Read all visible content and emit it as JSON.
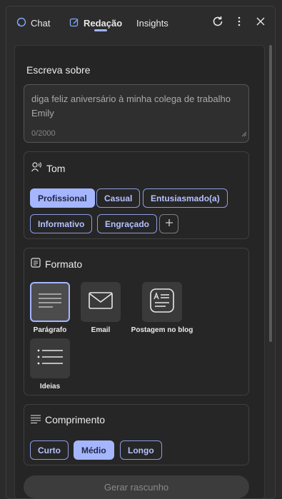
{
  "header": {
    "tabs": [
      {
        "label": "Chat",
        "icon": "chat-bubble-icon"
      },
      {
        "label": "Redação",
        "icon": "compose-icon",
        "active": true
      },
      {
        "label": "Insights"
      }
    ],
    "actions": [
      "refresh-icon",
      "more-vertical-icon",
      "close-icon"
    ]
  },
  "compose": {
    "label": "Escreva sobre",
    "text": "diga feliz aniversário à minha colega de trabalho Emily",
    "counter": "0/2000"
  },
  "tone": {
    "title": "Tom",
    "options": [
      "Profissional",
      "Casual",
      "Entusiasmado(a)",
      "Informativo",
      "Engraçado"
    ],
    "selected": "Profissional"
  },
  "format": {
    "title": "Formato",
    "options": [
      "Parágrafo",
      "Email",
      "Postagem no blog",
      "Ideias"
    ],
    "selected": "Parágrafo"
  },
  "length": {
    "title": "Comprimento",
    "options": [
      "Curto",
      "Médio",
      "Longo"
    ],
    "selected": "Médio"
  },
  "generate_label": "Gerar rascunho",
  "colors": {
    "background": "#2b2b2b",
    "accent": "#a5b6ff",
    "chip_text": "#b3c2ff"
  }
}
